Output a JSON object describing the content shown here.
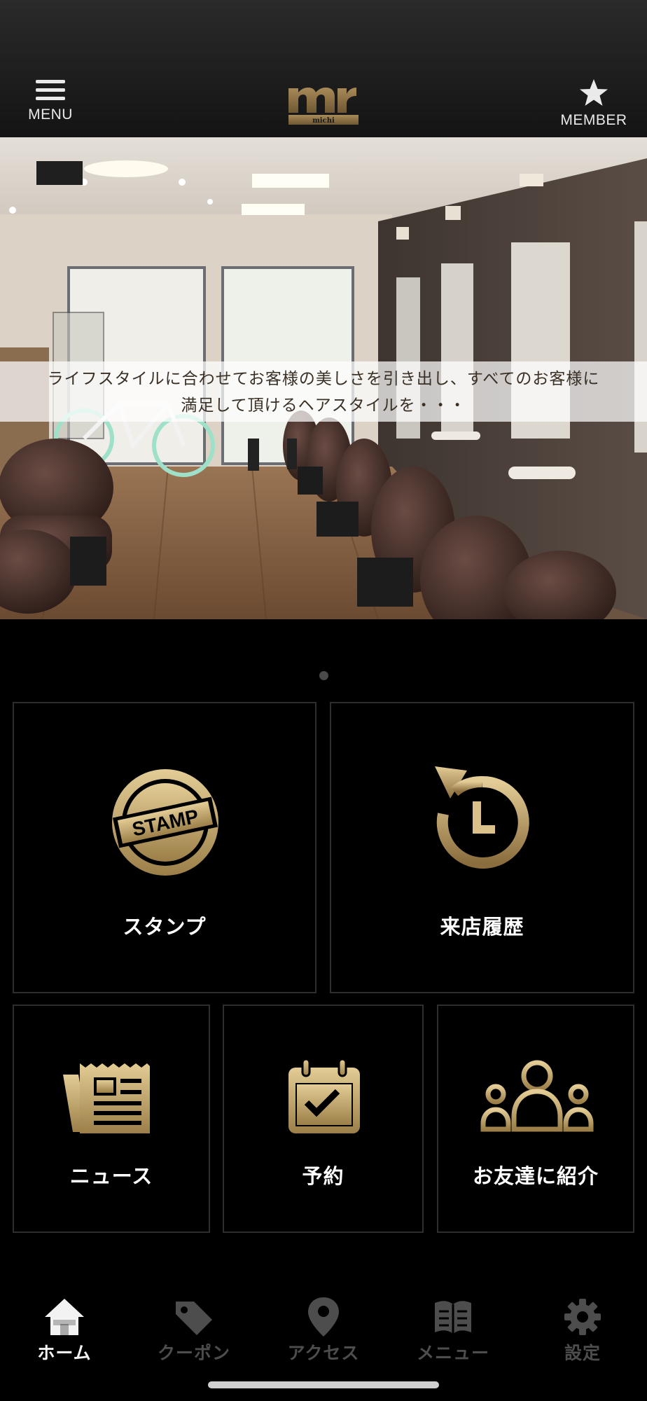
{
  "header": {
    "menu_label": "MENU",
    "member_label": "MEMBER",
    "logo_text": "michi",
    "menu_icon": "hamburger-icon",
    "member_icon": "star-icon"
  },
  "hero": {
    "caption_line1": "ライフスタイルに合わせてお客様の美しさを引き出し、すべてのお客様に",
    "caption_line2": "満足して頂けるヘアスタイルを・・・"
  },
  "tiles": {
    "stamp": {
      "label": "スタンプ",
      "icon_text": "STAMP"
    },
    "history": {
      "label": "来店履歴"
    },
    "news": {
      "label": "ニュース"
    },
    "reserve": {
      "label": "予約"
    },
    "refer": {
      "label": "お友達に紹介"
    }
  },
  "nav": {
    "items": [
      {
        "label": "ホーム",
        "icon": "home-icon",
        "active": true
      },
      {
        "label": "クーポン",
        "icon": "tag-icon",
        "active": false
      },
      {
        "label": "アクセス",
        "icon": "map-pin-icon",
        "active": false
      },
      {
        "label": "メニュー",
        "icon": "book-icon",
        "active": false
      },
      {
        "label": "設定",
        "icon": "gear-icon",
        "active": false
      }
    ]
  },
  "colors": {
    "gold": "#c8aa6e",
    "gold_dark": "#7a6338",
    "background": "#000000",
    "nav_inactive": "#4d4d4d"
  }
}
